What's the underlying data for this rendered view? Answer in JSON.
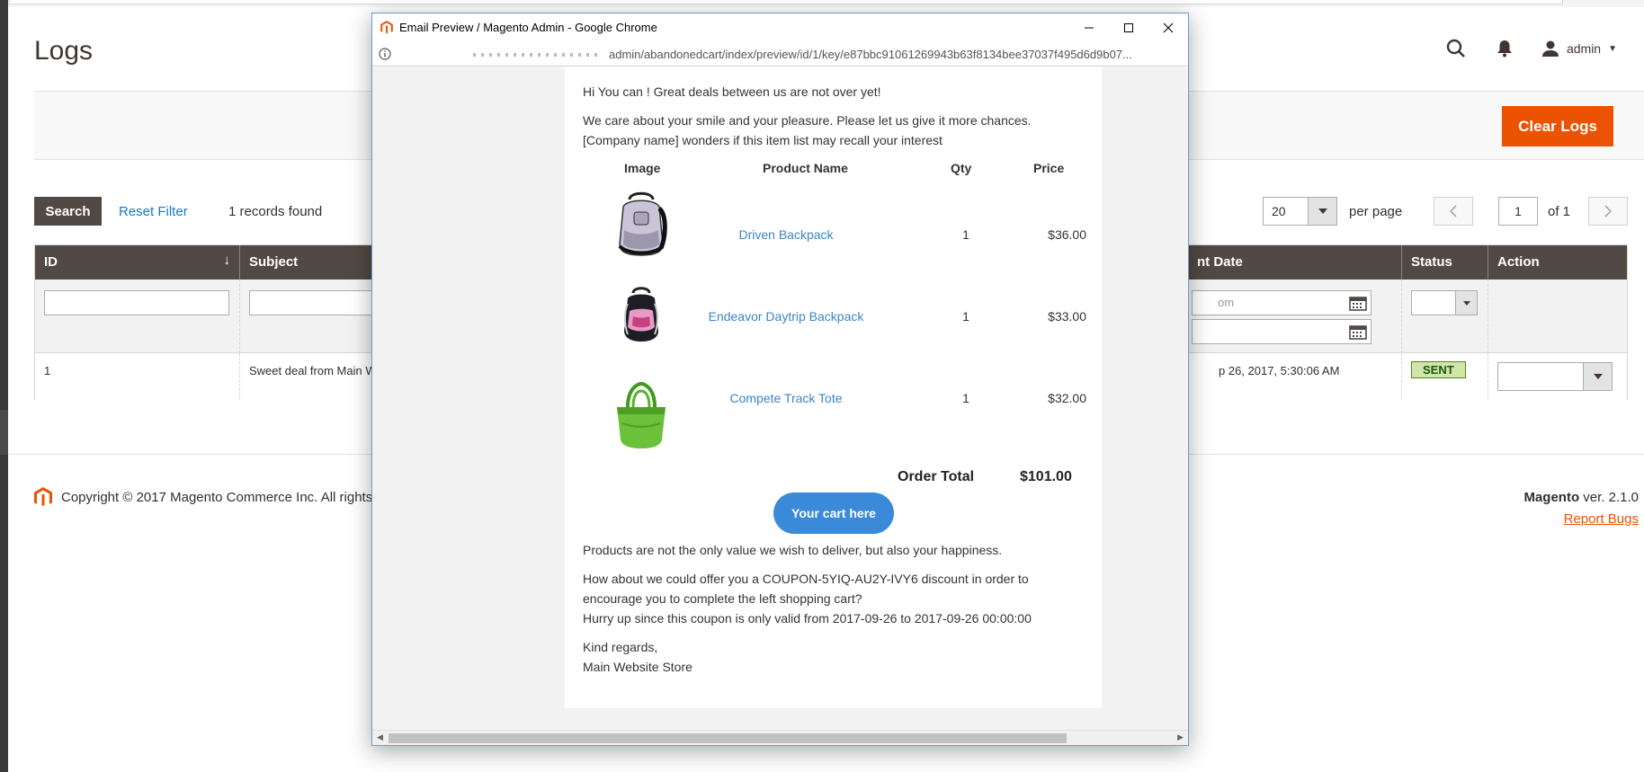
{
  "page": {
    "title": "Logs"
  },
  "header": {
    "user": "admin"
  },
  "toolbar": {
    "clear_logs_label": "Clear Logs"
  },
  "grid_controls": {
    "search_label": "Search",
    "reset_filter_label": "Reset Filter",
    "records_found": "1 records found",
    "per_page_value": "20",
    "per_page_label": "per page",
    "page_value": "1",
    "of_pages": "of 1"
  },
  "grid": {
    "columns": [
      "ID",
      "Subject",
      "nt Date",
      "Status",
      "Action"
    ],
    "filter_date_placeholder": "om",
    "rows": [
      {
        "id": "1",
        "subject": "Sweet deal from Main W",
        "sent_date": "p 26, 2017, 5:30:06 AM",
        "status": "SENT"
      }
    ]
  },
  "footer": {
    "copyright": "Copyright © 2017 Magento Commerce Inc. All rights r",
    "brand": "Magento",
    "version": "ver. 2.1.0",
    "report_bugs": "Report Bugs"
  },
  "popup": {
    "window_title": "Email Preview / Magento Admin - Google Chrome",
    "url": "admin/abandonedcart/index/preview/id/1/key/e87bbc91061269943b63f8134bee37037f495d6d9b07..."
  },
  "email": {
    "greeting": "Hi You can ! Great deals between us are not over yet!",
    "intro_line1": "We care about your smile and your pleasure. Please let us give it more chances.",
    "intro_line2": "[Company name] wonders if this item list may recall your interest",
    "table_headers": {
      "image": "Image",
      "product_name": "Product Name",
      "qty": "Qty",
      "price": "Price"
    },
    "products": [
      {
        "name": "Driven Backpack",
        "qty": "1",
        "price": "$36.00",
        "image_icon": "backpack-gray-icon"
      },
      {
        "name": "Endeavor Daytrip Backpack",
        "qty": "1",
        "price": "$33.00",
        "image_icon": "backpack-pink-icon"
      },
      {
        "name": "Compete Track Tote",
        "qty": "1",
        "price": "$32.00",
        "image_icon": "tote-green-icon"
      }
    ],
    "order_total_label": "Order Total",
    "order_total_value": "$101.00",
    "cart_button": "Your cart here",
    "para1": "Products are not the only value we wish to deliver, but also your happiness.",
    "para2_line1": "How about we could offer you a COUPON-5YIQ-AU2Y-IVY6 discount in order to",
    "para2_line2": "encourage you to complete the left shopping cart?",
    "para2_line3": "Hurry up since this coupon is only valid from 2017-09-26 to 2017-09-26 00:00:00",
    "closing1": "Kind regards,",
    "closing2": "Main Website Store"
  },
  "colors": {
    "accent_orange": "#eb5202",
    "grid_header": "#514943",
    "link_blue": "#1979c3",
    "email_button": "#3b8ad9",
    "status_sent_bg": "#d0e5a9"
  }
}
